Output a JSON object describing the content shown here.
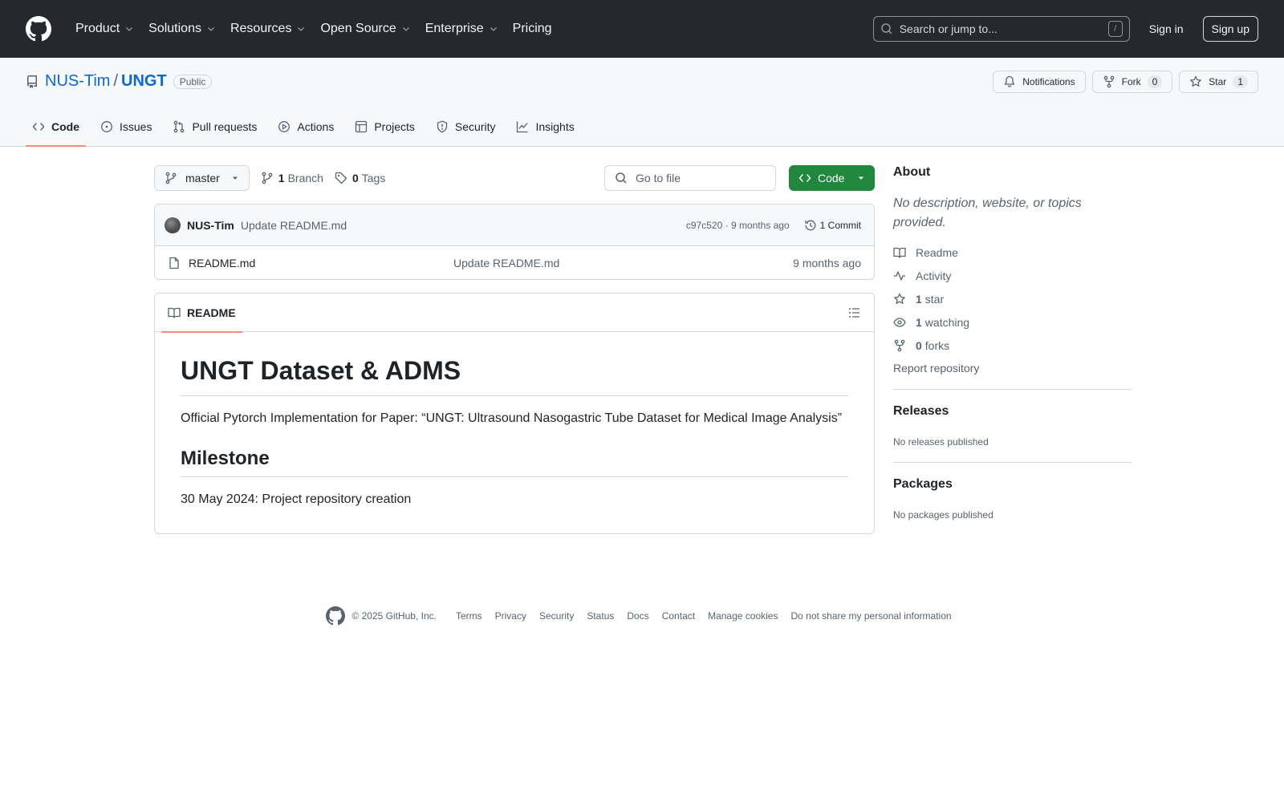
{
  "topnav": {
    "items": [
      "Product",
      "Solutions",
      "Resources",
      "Open Source",
      "Enterprise",
      "Pricing"
    ],
    "search_placeholder": "Search or jump to...",
    "search_key": "/",
    "signin": "Sign in",
    "signup": "Sign up"
  },
  "repo": {
    "owner": "NUS-Tim",
    "sep": "/",
    "name": "UNGT",
    "visibility": "Public",
    "notifications": "Notifications",
    "fork_label": "Fork",
    "fork_count": "0",
    "star_label": "Star",
    "star_count": "1"
  },
  "tabs": [
    "Code",
    "Issues",
    "Pull requests",
    "Actions",
    "Projects",
    "Security",
    "Insights"
  ],
  "toolbar": {
    "branch": "master",
    "branch_count": "1",
    "branch_label": "Branch",
    "tag_count": "0",
    "tag_label": "Tags",
    "goto_placeholder": "Go to file",
    "code_label": "Code"
  },
  "commit": {
    "author": "NUS-Tim",
    "message": "Update README.md",
    "meta": "c97c520 · 9 months ago",
    "count": "1 Commit"
  },
  "files": [
    {
      "name": "README.md",
      "message": "Update README.md",
      "age": "9 months ago"
    }
  ],
  "readme": {
    "tab": "README",
    "h1": "UNGT Dataset & ADMS",
    "p1": "Official Pytorch Implementation for Paper: “UNGT: Ultrasound Nasogastric Tube Dataset for Medical Image Analysis”",
    "h2": "Milestone",
    "p2": "30 May 2024: Project repository creation"
  },
  "sidebar": {
    "about_title": "About",
    "about_desc": "No description, website, or topics provided.",
    "readme": "Readme",
    "activity": "Activity",
    "stars_count": "1",
    "stars_label": "star",
    "watching_count": "1",
    "watching_label": "watching",
    "forks_count": "0",
    "forks_label": "forks",
    "report": "Report repository",
    "releases_title": "Releases",
    "releases_note": "No releases published",
    "packages_title": "Packages",
    "packages_note": "No packages published"
  },
  "footer": {
    "copyright": "© 2025 GitHub, Inc.",
    "links": [
      "Terms",
      "Privacy",
      "Security",
      "Status",
      "Docs",
      "Contact",
      "Manage cookies",
      "Do not share my personal information"
    ]
  },
  "colors": {
    "header_bg": "#25292e",
    "link": "#0969da",
    "code_button": "#1f883d",
    "tab_underline": "#fd8c73"
  }
}
